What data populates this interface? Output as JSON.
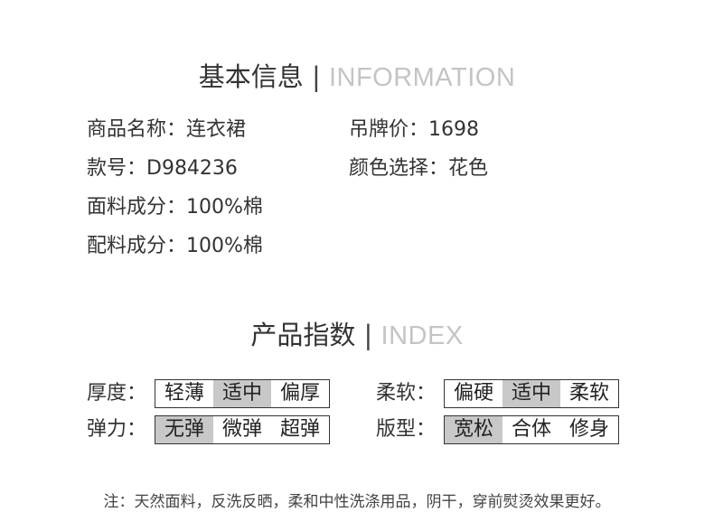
{
  "basic_info": {
    "title_cn": "基本信息",
    "separator": "|",
    "title_en": "INFORMATION",
    "product_name": "商品名称：连衣裙",
    "tag_price": "吊牌价：1698",
    "style_no": "款号：D984236",
    "color": "颜色选择：花色",
    "fabric": "面料成分：100%棉",
    "lining": "配料成分：100%棉"
  },
  "index": {
    "title_cn": "产品指数",
    "separator": "|",
    "title_en": "INDEX",
    "thickness": {
      "label": "厚度：",
      "options": [
        "轻薄",
        "适中",
        "偏厚"
      ],
      "selected": "适中"
    },
    "softness": {
      "label": "柔软：",
      "options": [
        "偏硬",
        "适中",
        "柔软"
      ],
      "selected": "适中"
    },
    "elasticity": {
      "label": "弹力：",
      "options": [
        "无弹",
        "微弹",
        "超弹"
      ],
      "selected": "无弹"
    },
    "fit": {
      "label": "版型：",
      "options": [
        "宽松",
        "合体",
        "修身"
      ],
      "selected": "宽松"
    }
  },
  "note": "注：天然面料，反洗反晒，柔和中性洗涤用品，阴干，穿前熨烫效果更好。",
  "colors": {
    "selected_bg": "#c8c8c8",
    "text": "#333333",
    "english_title": "#c4c4c4"
  }
}
